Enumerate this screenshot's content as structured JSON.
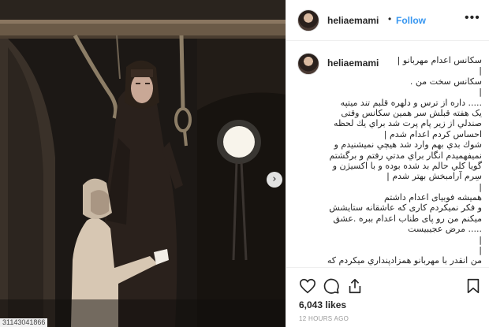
{
  "post": {
    "username": "heliaemami",
    "separator": "•",
    "follow_label": "Follow",
    "more_label": "•••",
    "media_id": "31143041866",
    "carousel_next": "›"
  },
  "caption": {
    "lines": [
      "سکانس اعدام مهربانو |",
      "|",
      "سکانس سخت من .",
      "|",
      "..... داره از ترس و دلهره قلبم تند میتپه",
      "یک هفته قبلش سر همین سکانس وقتی",
      "صندلي از زير پام پرت شد براي يك لحظه",
      "احساس کردم اعدام شدم |",
      "شوك بدي بهم وارد شد هيچي نميشنيدم و",
      "نميفهميدم انگار براي مدتي رفتم و برگشتم",
      "گويا كلي حالم بد شده بوده و با اكسيژن و",
      "سِرم آرامبخش بهتر شدم |",
      "|",
      "همیشه فوبیای اعدام داشتم",
      "و فکر نمیکردم کاری که عاشقانه ستایشش",
      "میکنم من رو پای طناب اعدام ببره .عشق",
      "..... مرض عجیبیست",
      "|",
      "|",
      "من انقدر با مهربانو همزادپنداري ميكردم كه"
    ]
  },
  "actions": {
    "like_icon": "heart-icon",
    "comment_icon": "comment-icon",
    "share_icon": "share-icon",
    "save_icon": "bookmark-icon",
    "likes": "6,043 likes",
    "timestamp": "12 HOURS AGO"
  }
}
